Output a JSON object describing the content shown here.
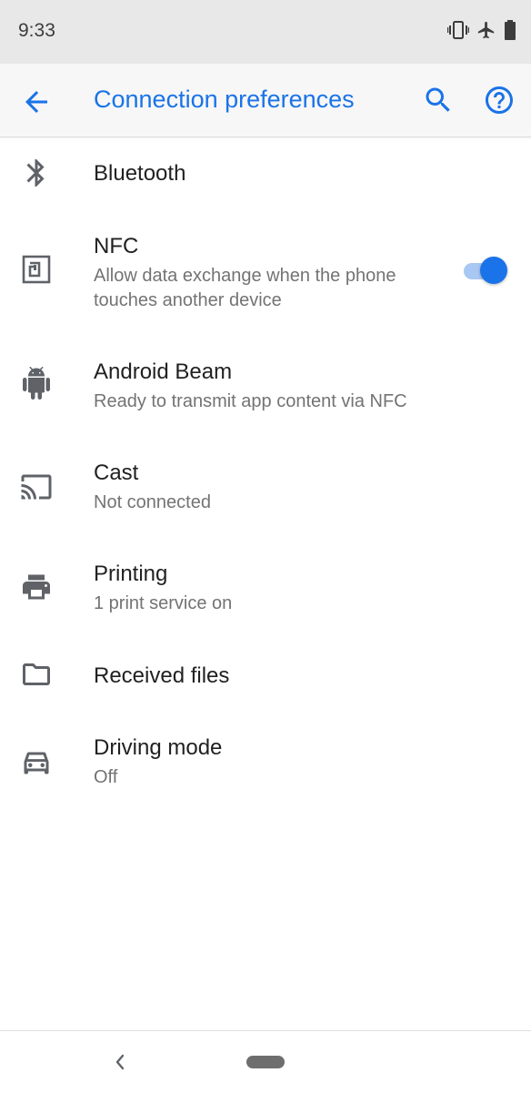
{
  "status_bar": {
    "time": "9:33",
    "icons": [
      "vibrate-icon",
      "airplane-icon",
      "battery-icon"
    ]
  },
  "app_bar": {
    "title": "Connection preferences",
    "back_icon": "arrow-back-icon",
    "search_icon": "search-icon",
    "help_icon": "help-icon",
    "accent_color": "#1a73e8"
  },
  "items": [
    {
      "label": "Bluetooth",
      "subtitle": "",
      "icon": "bluetooth-icon"
    },
    {
      "label": "NFC",
      "subtitle": "Allow data exchange when the phone touches another device",
      "icon": "nfc-icon",
      "toggle": true
    },
    {
      "label": "Android Beam",
      "subtitle": "Ready to transmit app content via NFC",
      "icon": "android-icon"
    },
    {
      "label": "Cast",
      "subtitle": "Not connected",
      "icon": "cast-icon"
    },
    {
      "label": "Printing",
      "subtitle": "1 print service on",
      "icon": "print-icon"
    },
    {
      "label": "Received files",
      "subtitle": "",
      "icon": "folder-icon"
    },
    {
      "label": "Driving mode",
      "subtitle": "Off",
      "icon": "car-icon"
    }
  ],
  "nav_bar": {
    "back_icon": "nav-back-icon",
    "home_icon": "home-pill-icon"
  }
}
